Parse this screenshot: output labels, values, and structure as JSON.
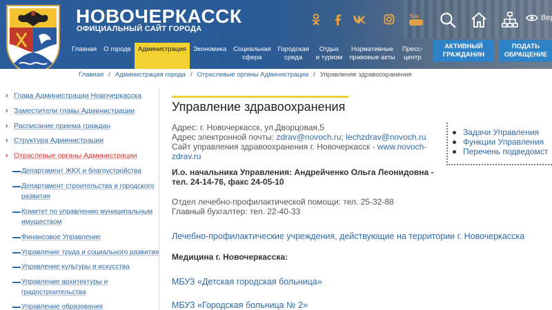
{
  "header": {
    "title": "НОВОЧЕРКАССК",
    "subtitle": "ОФИЦИАЛЬНЫЙ САЙТ ГОРОДА",
    "social_icons": [
      "odnoklassniki-icon",
      "facebook-icon",
      "vk-icon",
      "instagram-icon",
      "youtube-icon"
    ],
    "youtube_label": "You",
    "tool_icons": [
      "search-icon",
      "home-icon",
      "sitemap-icon",
      "eye-icon"
    ],
    "vision_label": "Вер",
    "nav": [
      {
        "line1": "Главная",
        "line2": ""
      },
      {
        "line1": "О городе",
        "line2": ""
      },
      {
        "line1": "Администрация",
        "line2": ""
      },
      {
        "line1": "Экономика",
        "line2": ""
      },
      {
        "line1": "Социальная",
        "line2": "сфера"
      },
      {
        "line1": "Городская",
        "line2": "среда"
      },
      {
        "line1": "Отдых",
        "line2": "и туризм"
      },
      {
        "line1": "Нормативные",
        "line2": "правовые акты"
      },
      {
        "line1": "Пресс-",
        "line2": "центр"
      }
    ],
    "active_nav": "Администрация",
    "btn_active_citizen": {
      "line1": "АКТИВНЫЙ",
      "line2": "ГРАЖДАНИН"
    },
    "btn_submit_request": {
      "line1": "ПОДАТЬ",
      "line2": "ОБРАЩЕНИЕ"
    }
  },
  "breadcrumb": {
    "items": [
      "Главная",
      "Администрация города",
      "Отраслевые органы Администрации"
    ],
    "current": "Управление здравоохранения",
    "separator": "/"
  },
  "sidebar": {
    "items": [
      "Глава Администрации Новочеркасска",
      "Заместители главы Администрации",
      "Расписание приема граждан",
      "Структура Администрации",
      "Отраслевые органы Администрации"
    ],
    "active_index": 4,
    "sub_items": [
      {
        "line1": "Департамент ЖКХ и благоустройства",
        "line2": ""
      },
      {
        "line1": "Департамент строительства и городского",
        "line2": "развития"
      },
      {
        "line1": "Комитет по управлению муниципальным",
        "line2": "имуществом"
      },
      {
        "line1": "Финансовое Управление",
        "line2": ""
      },
      {
        "line1": "Управление труда и социального развития",
        "line2": ""
      },
      {
        "line1": "Управление культуры и искусства",
        "line2": ""
      },
      {
        "line1": "Управление архитектуры и",
        "line2": "градостроительства"
      },
      {
        "line1": "Управление образования",
        "line2": ""
      }
    ]
  },
  "main": {
    "title": "Управление здравоохранения",
    "address": "Адрес: г. Новочеркасск, ул.Дворцовая,5",
    "email_label": "Адрес электронной почты: ",
    "email1": "zdrav@novoch.ru",
    "email_sep": "; ",
    "email2": "lechzdrav@novoch.ru",
    "site_label": "Сайт управления здравоохранения г. Новочеркасск - ",
    "site_url_line1": "www.novoch-",
    "site_url_line2": "zdrav.ru",
    "head_line1": "И.о. начальника Управления: Андрейченко Ольга Леонидовна -",
    "head_line2": "тел. 24-14-76, факс 24-05-10",
    "dept_line": "Отдел лечебно-профилактической помощи: тел. 25-32-88",
    "accountant_line": "Главный бухгалтер: тел. 22-40-33",
    "institutions_link": "Лечебно-профилактические учреждения, действующие на территории г. Новочеркасска",
    "medicine_heading": "Медицина г. Новочеркасска:",
    "hospital1": "МБУЗ «Детская городская больница»",
    "hospital2": "МБУЗ «Городская больница № 2»"
  },
  "right_menu": {
    "items": [
      "Задачи Управления",
      "Функции Управления",
      "Перечень подведомст"
    ]
  },
  "colors": {
    "header_blue": "#2b5d9c",
    "nav_active": "#f2d230",
    "button_blue": "#2d83c6",
    "link_blue": "#2f6aa6",
    "active_red": "#d9302b"
  }
}
